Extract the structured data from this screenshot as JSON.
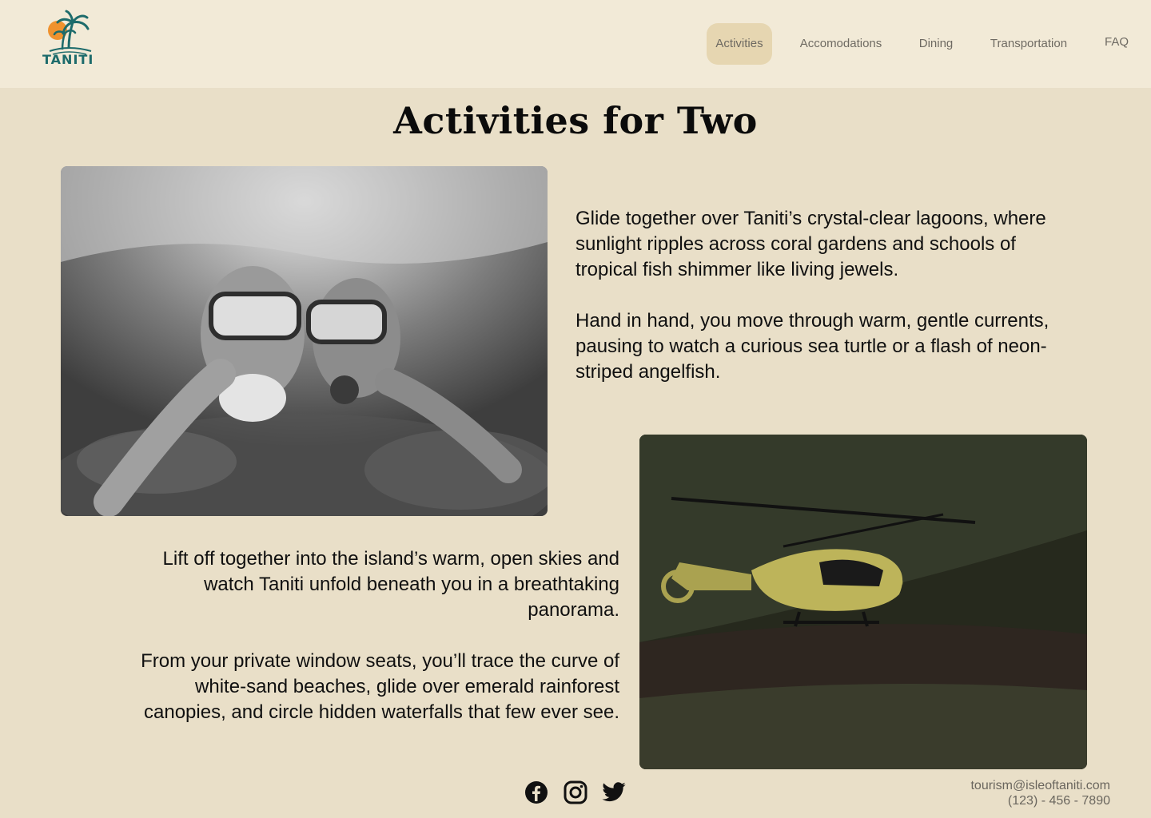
{
  "brand": {
    "name": "TANITI"
  },
  "nav": {
    "items": [
      {
        "label": "Activities",
        "active": true
      },
      {
        "label": "Accomodations",
        "active": false
      },
      {
        "label": "Dining",
        "active": false
      },
      {
        "label": "Transportation",
        "active": false
      },
      {
        "label": "FAQ",
        "active": false
      }
    ]
  },
  "page": {
    "title": "Activities for Two"
  },
  "sections": {
    "snorkel": {
      "p1": "Glide together over Taniti’s crystal-clear lagoons, where sunlight ripples across coral gardens and schools of tropical fish shimmer like living jewels.",
      "p2": "Hand in hand, you move through warm, gentle currents, pausing to watch a curious sea turtle or a flash of neon-striped angelfish."
    },
    "helicopter": {
      "p1": "Lift off together into the island’s warm, open skies and watch Taniti unfold beneath you in a breathtaking panorama.",
      "p2": "From your private window seats, you’ll trace the curve of white-sand beaches, glide over emerald rainforest canopies, and circle hidden waterfalls that few ever see."
    }
  },
  "footer": {
    "social_icons": [
      "facebook-icon",
      "instagram-icon",
      "twitter-icon"
    ],
    "email": "tourism@isleoftaniti.com",
    "phone": "(123) - 456 - 7890"
  },
  "colors": {
    "background": "#e9dfc8",
    "header": "#f2ead7",
    "nav_active": "#e6d6b1",
    "brand_teal": "#1d6b6b",
    "brand_orange": "#f0922e"
  }
}
